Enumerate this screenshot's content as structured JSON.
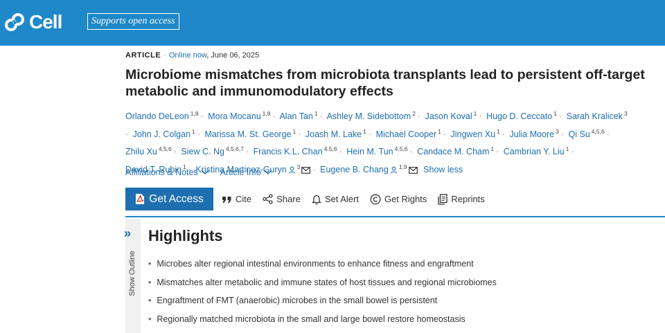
{
  "header": {
    "brand": "Cell",
    "open_access_label": "Supports open access",
    "brand_color": "#1e88c8"
  },
  "article": {
    "type": "ARTICLE",
    "status": "Online now",
    "date": "June 06, 2025",
    "title": "Microbiome mismatches from microbiota transplants lead to persistent off-target metabolic and immunomodulatory effects"
  },
  "authors": [
    {
      "name": "Orlando DeLeon",
      "aff": "1,8"
    },
    {
      "name": "Mora Mocanu",
      "aff": "1,8"
    },
    {
      "name": "Alan Tan",
      "aff": "1"
    },
    {
      "name": "Ashley M. Sidebottom",
      "aff": "2"
    },
    {
      "name": "Jason Koval",
      "aff": "1"
    },
    {
      "name": "Hugo D. Ceccato",
      "aff": "1"
    },
    {
      "name": "Sarah Kralicek",
      "aff": "3"
    },
    {
      "name": "John J. Colgan",
      "aff": "1"
    },
    {
      "name": "Marissa M. St. George",
      "aff": "1"
    },
    {
      "name": "Joash M. Lake",
      "aff": "1"
    },
    {
      "name": "Michael Cooper",
      "aff": "1"
    },
    {
      "name": "Jingwen Xu",
      "aff": "1"
    },
    {
      "name": "Julia Moore",
      "aff": "3"
    },
    {
      "name": "Qi Su",
      "aff": "4,5,6"
    },
    {
      "name": "Zhilu Xu",
      "aff": "4,5,6"
    },
    {
      "name": "Siew C. Ng",
      "aff": "4,5,6,7"
    },
    {
      "name": "Francis K.L. Chan",
      "aff": "4,5,6"
    },
    {
      "name": "Hein M. Tun",
      "aff": "4,5,6"
    },
    {
      "name": "Candace M. Cham",
      "aff": "1"
    },
    {
      "name": "Cambrian Y. Liu",
      "aff": "1"
    },
    {
      "name": "David T. Rubin",
      "aff": "1"
    },
    {
      "name": "Kristina Martinez-Guryn",
      "aff": "3"
    },
    {
      "name": "Eugene B. Chang",
      "aff": "1,9"
    }
  ],
  "show_less": "Show less",
  "dropdowns": {
    "affiliations": "Affiliations & Notes",
    "article_info": "Article Info"
  },
  "toolbar": {
    "get_access": "Get Access",
    "cite": "Cite",
    "share": "Share",
    "set_alert": "Set Alert",
    "get_rights": "Get Rights",
    "reprints": "Reprints"
  },
  "outline": {
    "label": "Show Outline"
  },
  "highlights": {
    "title": "Highlights",
    "items": [
      "Microbes alter regional intestinal environments to enhance fitness and engraftment",
      "Mismatches alter metabolic and immune states of host tissues and regional microbiomes",
      "Engraftment of FMT (anaerobic) microbes in the small bowel is persistent",
      "Regionally matched microbiota in the small and large bowel restore homeostasis"
    ]
  }
}
